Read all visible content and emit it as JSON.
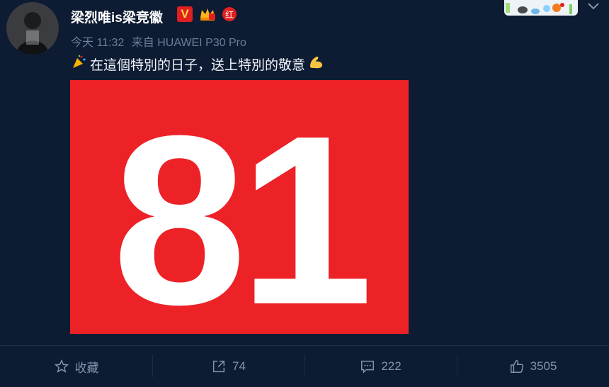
{
  "post": {
    "author": "梁烈唯is梁竞徽",
    "badges": {
      "verified": "V",
      "red": "红"
    },
    "time": "今天 11:32",
    "source": "来自 HUAWEI P30 Pro",
    "text": "在這個特別的日子，送上特別的敬意",
    "leading_emoji": "party-popper-icon",
    "trailing_emoji": "flexed-biceps-icon",
    "image_text": "81",
    "image_bg": "#ec2227"
  },
  "actions": {
    "favorite_label": "收藏",
    "repost_count": "74",
    "comment_count": "222",
    "like_count": "3505"
  },
  "colors": {
    "background": "#0d1b33",
    "muted": "#6e7f99",
    "accent_red": "#e02020"
  }
}
